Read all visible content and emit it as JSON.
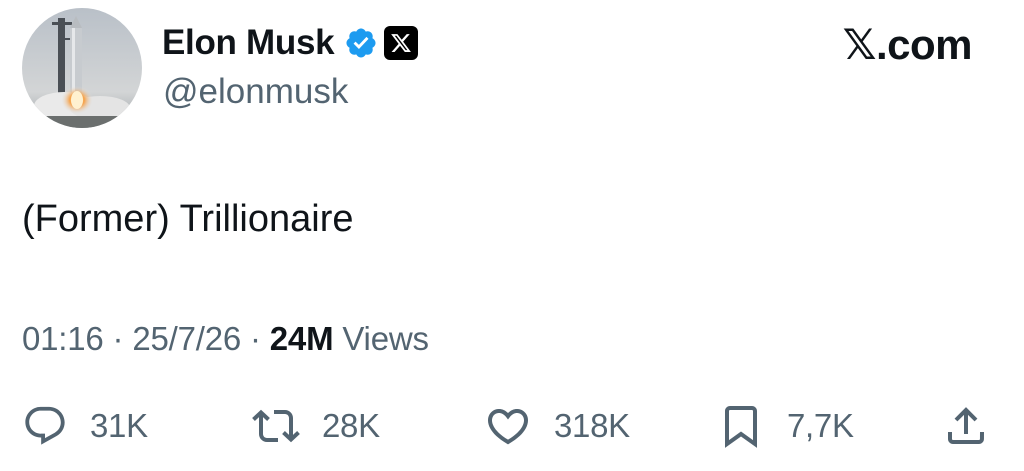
{
  "author": {
    "display_name": "Elon Musk",
    "handle": "@elonmusk",
    "verified_badge_color": "#1d9bf0",
    "affiliate_badge_icon": "x-logo-icon",
    "avatar_icon": "rocket-launch-avatar"
  },
  "site_label": "𝕏.com",
  "tweet": {
    "text": "(Former) Trillionaire"
  },
  "meta": {
    "time": "01:16",
    "separator": " · ",
    "date": "25/7/26",
    "views_count": "24M",
    "views_label": " Views"
  },
  "actions": {
    "reply": {
      "icon": "reply-icon",
      "count": "31K"
    },
    "repost": {
      "icon": "repost-icon",
      "count": "28K"
    },
    "like": {
      "icon": "heart-icon",
      "count": "318K"
    },
    "bookmark": {
      "icon": "bookmark-icon",
      "count": "7,7K"
    },
    "share": {
      "icon": "share-icon"
    }
  },
  "colors": {
    "text_primary": "#0f1419",
    "text_secondary": "#536471",
    "icon": "#536471"
  }
}
